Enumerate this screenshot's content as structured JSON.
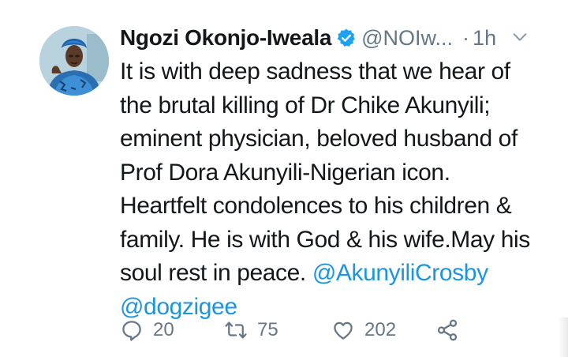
{
  "tweet": {
    "author": {
      "name": "Ngozi Okonjo-Iweala",
      "handle": "@NOIw...",
      "separator": "·",
      "time": "1h"
    },
    "text_before_mentions": "It is with deep sadness that we hear of the brutal killing of Dr Chike Akunyili; eminent physician, beloved husband of Prof Dora Akunyili-Nigerian icon. Heartfelt condolences to his children & family. He is with God & his wife.May his soul rest in peace.",
    "mentions": [
      "@AkunyiliCrosby",
      "@dogzigee"
    ],
    "actions": {
      "reply_count": "20",
      "retweet_count": "75",
      "like_count": "202"
    }
  },
  "colors": {
    "text": "#14171a",
    "secondary": "#657786",
    "link": "#1b95e0",
    "verified": "#1da1f2"
  },
  "icons": [
    "verified-badge-icon",
    "chevron-down-icon",
    "reply-icon",
    "retweet-icon",
    "like-icon",
    "share-icon"
  ]
}
